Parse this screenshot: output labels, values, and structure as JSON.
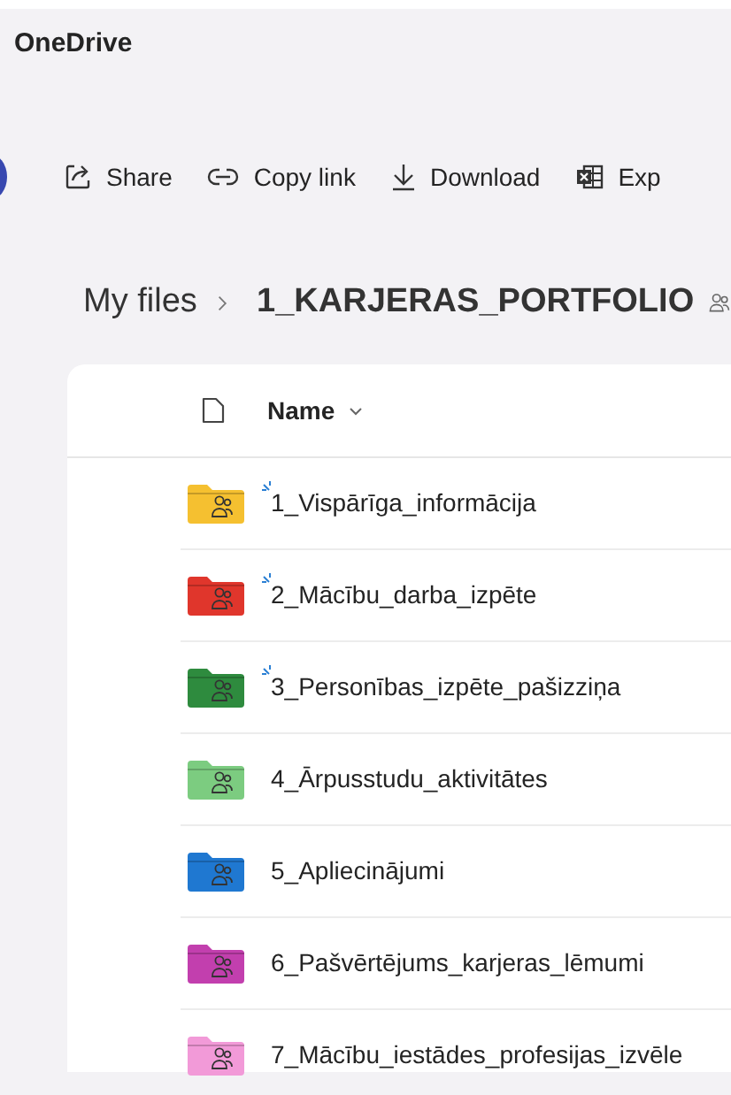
{
  "app": {
    "title": "OneDrive"
  },
  "toolbar": [
    {
      "kind": "share",
      "label": "Share"
    },
    {
      "kind": "link",
      "label": "Copy link"
    },
    {
      "kind": "download",
      "label": "Download"
    },
    {
      "kind": "excel",
      "label": "Exp"
    }
  ],
  "breadcrumb": {
    "root": "My files",
    "current": "1_KARJERAS_PORTFOLIO",
    "shared": true
  },
  "table": {
    "columns": [
      {
        "label": "Name",
        "sorted": true
      }
    ],
    "rows": [
      {
        "name": "1_Vispārīga_informācija",
        "color": "#f5c030",
        "is_new": true
      },
      {
        "name": "2_Mācību_darba_izpēte",
        "color": "#e0362c",
        "is_new": true
      },
      {
        "name": "3_Personības_izpēte_pašizziņa",
        "color": "#2e8b3e",
        "is_new": true
      },
      {
        "name": "4_Ārpusstudu_aktivitātes",
        "color": "#7ccc80",
        "is_new": false
      },
      {
        "name": "5_Apliecinājumi",
        "color": "#1f78d1",
        "is_new": false
      },
      {
        "name": "6_Pašvērtējums_karjeras_lēmumi",
        "color": "#c23fae",
        "is_new": false
      },
      {
        "name": "7_Mācību_iestādes_profesijas_izvēle",
        "color": "#f29ad8",
        "is_new": false
      }
    ]
  }
}
